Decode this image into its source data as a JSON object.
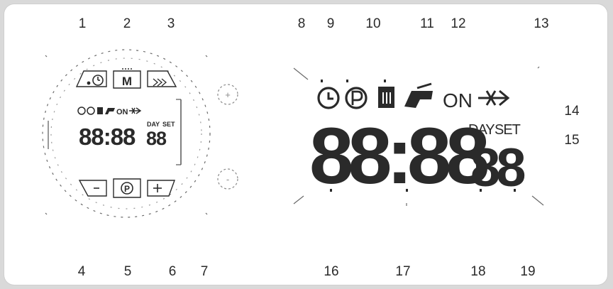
{
  "callouts": {
    "n1": "1",
    "n2": "2",
    "n3": "3",
    "n4": "4",
    "n5": "5",
    "n6": "6",
    "n7": "7",
    "n8": "8",
    "n9": "9",
    "n10": "10",
    "n11": "11",
    "n12": "12",
    "n13": "13",
    "n14": "14",
    "n15": "15",
    "n16": "16",
    "n17": "17",
    "n18": "18",
    "n19": "19"
  },
  "small_display": {
    "time": "88:88",
    "day": "88",
    "on_label": "ON",
    "day_label": "DAY",
    "set_label": "SET"
  },
  "large_display": {
    "time": "88:88",
    "day": "88",
    "on_label": "ON",
    "day_label": "DAY",
    "set_label": "SET"
  },
  "knob_plus": "+",
  "knob_minus": "-",
  "icons": [
    "timer-icon",
    "menu-m-icon",
    "fast-forward-icon",
    "minus-icon",
    "program-p-icon",
    "plus-icon",
    "clock-icon",
    "p-circle-icon",
    "bin-icon",
    "water-tap-icon",
    "flow-arrow-icon"
  ],
  "colors": {
    "ink": "#2a2a2a",
    "background": "#ffffff",
    "frame": "#d9d9d9"
  }
}
